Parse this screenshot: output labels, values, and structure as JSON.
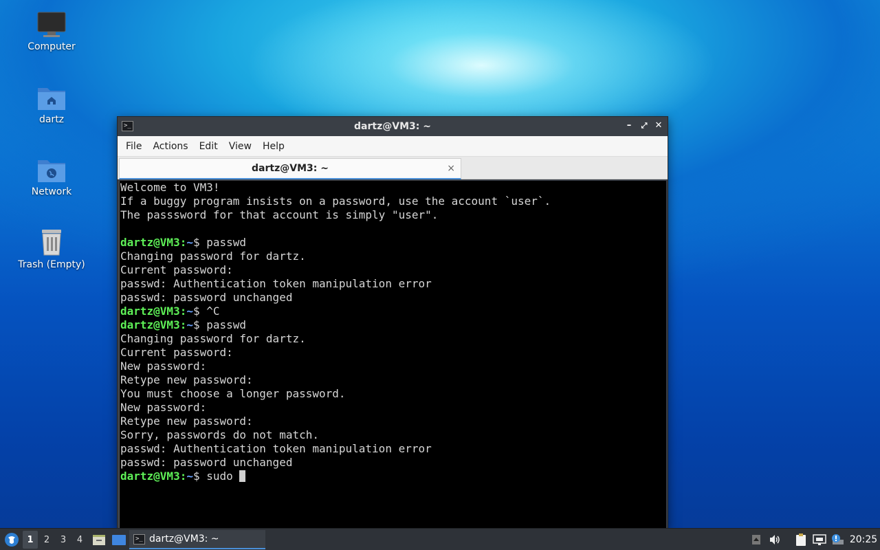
{
  "desktop": {
    "icons": [
      {
        "label": "Computer"
      },
      {
        "label": "dartz"
      },
      {
        "label": "Network"
      },
      {
        "label": "Trash (Empty)"
      }
    ]
  },
  "window": {
    "title": "dartz@VM3: ~",
    "menu": [
      "File",
      "Actions",
      "Edit",
      "View",
      "Help"
    ],
    "tab_label": "dartz@VM3: ~",
    "tab_close": "×"
  },
  "terminal": {
    "prompt_user": "dartz@VM3",
    "prompt_sep": ":",
    "prompt_path": "~",
    "prompt_dollar": "$ ",
    "lines": [
      {
        "type": "text",
        "text": "Welcome to VM3!"
      },
      {
        "type": "text",
        "text": "If a buggy program insists on a password, use the account `user`."
      },
      {
        "type": "text",
        "text": "The passsword for that account is simply \"user\"."
      },
      {
        "type": "text",
        "text": ""
      },
      {
        "type": "prompt",
        "cmd": "passwd"
      },
      {
        "type": "text",
        "text": "Changing password for dartz."
      },
      {
        "type": "text",
        "text": "Current password:"
      },
      {
        "type": "text",
        "text": "passwd: Authentication token manipulation error"
      },
      {
        "type": "text",
        "text": "passwd: password unchanged"
      },
      {
        "type": "prompt",
        "cmd": "^C"
      },
      {
        "type": "prompt",
        "cmd": "passwd"
      },
      {
        "type": "text",
        "text": "Changing password for dartz."
      },
      {
        "type": "text",
        "text": "Current password:"
      },
      {
        "type": "text",
        "text": "New password:"
      },
      {
        "type": "text",
        "text": "Retype new password:"
      },
      {
        "type": "text",
        "text": "You must choose a longer password."
      },
      {
        "type": "text",
        "text": "New password:"
      },
      {
        "type": "text",
        "text": "Retype new password:"
      },
      {
        "type": "text",
        "text": "Sorry, passwords do not match."
      },
      {
        "type": "text",
        "text": "passwd: Authentication token manipulation error"
      },
      {
        "type": "text",
        "text": "passwd: password unchanged"
      },
      {
        "type": "prompt",
        "cmd": "sudo ",
        "cursor": true
      }
    ]
  },
  "taskbar": {
    "workspaces": [
      "1",
      "2",
      "3",
      "4"
    ],
    "active_workspace": "1",
    "task_label": "dartz@VM3: ~",
    "clock": "20:25"
  },
  "colors": {
    "prompt_user": "#5ef057",
    "prompt_path": "#6aa3ff",
    "terminal_bg": "#000000",
    "terminal_fg": "#d6d6d6",
    "accent": "#4a90d9"
  }
}
